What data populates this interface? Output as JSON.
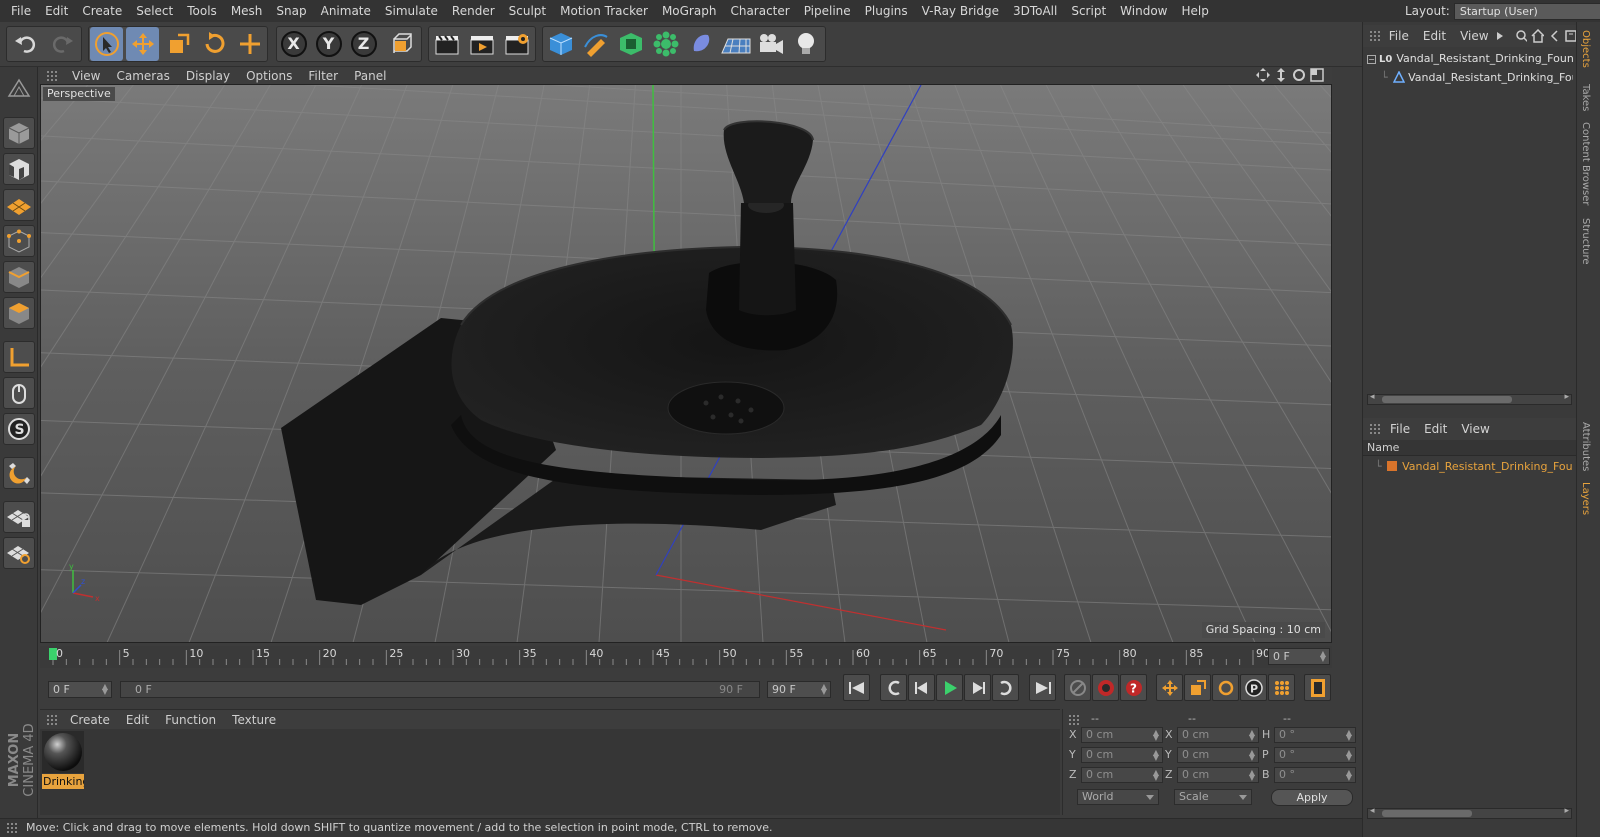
{
  "menu": [
    "File",
    "Edit",
    "Create",
    "Select",
    "Tools",
    "Mesh",
    "Snap",
    "Animate",
    "Simulate",
    "Render",
    "Sculpt",
    "Motion Tracker",
    "MoGraph",
    "Character",
    "Pipeline",
    "Plugins",
    "V-Ray Bridge",
    "3DToAll",
    "Script",
    "Window",
    "Help"
  ],
  "layout": {
    "label": "Layout:",
    "value": "Startup (User)"
  },
  "toolbar": {
    "axis_x": "X",
    "axis_y": "Y",
    "axis_z": "Z"
  },
  "viewport": {
    "menu": [
      "View",
      "Cameras",
      "Display",
      "Options",
      "Filter",
      "Panel"
    ],
    "camera_label": "Perspective",
    "grid_spacing": "Grid Spacing : 10 cm"
  },
  "timeline": {
    "ticks": [
      "0",
      "5",
      "10",
      "15",
      "20",
      "25",
      "30",
      "35",
      "40",
      "45",
      "50",
      "55",
      "60",
      "65",
      "70",
      "75",
      "80",
      "85",
      "90"
    ],
    "current_frame": "0 F",
    "start_frame": "0 F",
    "range_start": "0 F",
    "range_end": "90 F",
    "end_frame": "90 F"
  },
  "material_manager": {
    "menu": [
      "Create",
      "Edit",
      "Function",
      "Texture"
    ],
    "material_name": "Drinking"
  },
  "coordinates": {
    "headers": [
      "--",
      "--",
      "--"
    ],
    "position": [
      {
        "axis": "X",
        "value": "0 cm"
      },
      {
        "axis": "Y",
        "value": "0 cm"
      },
      {
        "axis": "Z",
        "value": "0 cm"
      }
    ],
    "size": [
      {
        "axis": "X",
        "value": "0 cm"
      },
      {
        "axis": "Y",
        "value": "0 cm"
      },
      {
        "axis": "Z",
        "value": "0 cm"
      }
    ],
    "rotation": [
      {
        "axis": "H",
        "value": "0 °"
      },
      {
        "axis": "P",
        "value": "0 °"
      },
      {
        "axis": "B",
        "value": "0 °"
      }
    ],
    "mode": "World",
    "scale_mode": "Scale",
    "apply": "Apply"
  },
  "status": "Move: Click and drag to move elements. Hold down SHIFT to quantize movement / add to the selection in point mode, CTRL to remove.",
  "objects_panel": {
    "menu": [
      "File",
      "Edit",
      "View"
    ],
    "items": [
      "Vandal_Resistant_Drinking_Fountain",
      "Vandal_Resistant_Drinking_Fountain"
    ]
  },
  "layers_panel": {
    "menu": [
      "File",
      "Edit",
      "View"
    ],
    "column": "Name",
    "items": [
      "Vandal_Resistant_Drinking_Fountain"
    ]
  },
  "side_tabs": [
    "Objects",
    "Takes",
    "Content Browser",
    "Structure",
    "Attributes",
    "Layers"
  ],
  "brand": {
    "maxon": "MAXON",
    "product": "CINEMA 4D"
  },
  "colors": {
    "accent": "#e8a33d",
    "selection": "#6f8ab3",
    "layer_color": "#d9742b"
  }
}
